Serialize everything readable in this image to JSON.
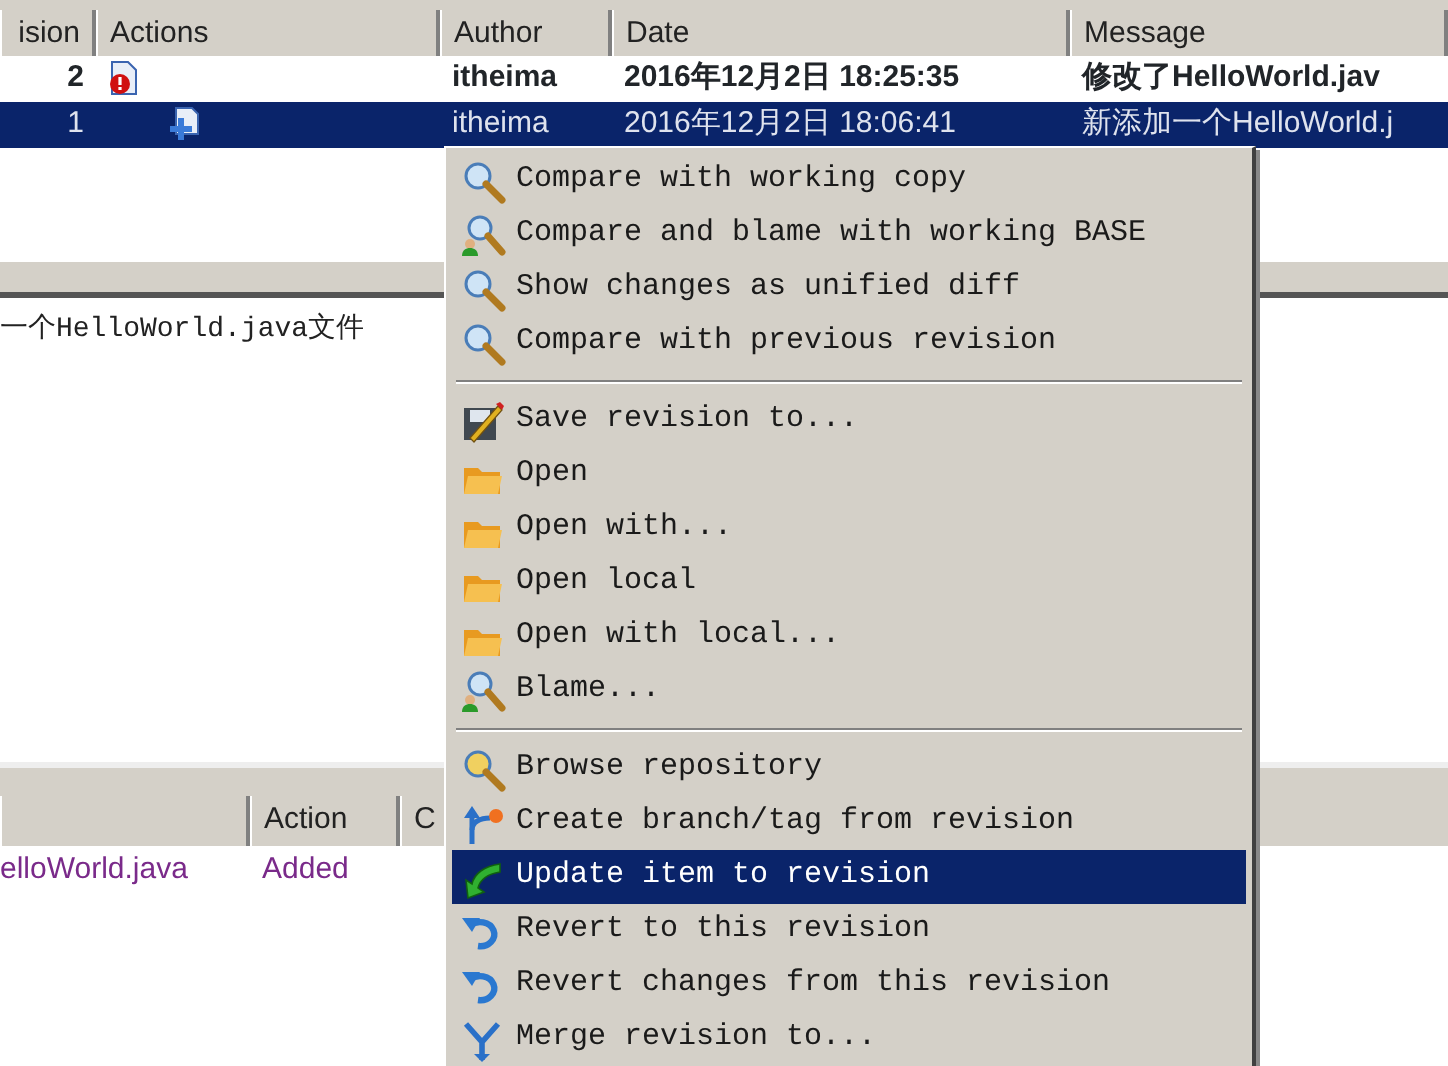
{
  "log_table": {
    "columns": [
      "ision",
      "Actions",
      "Author",
      "Date",
      "Message"
    ],
    "rows": [
      {
        "revision": "2",
        "kind": "modified",
        "author": "itheima",
        "date": "2016年12月2日 18:25:35",
        "message": "修改了HelloWorld.jav",
        "current": true,
        "selected": false
      },
      {
        "revision": "1",
        "kind": "added",
        "author": "itheima",
        "date": "2016年12月2日 18:06:41",
        "message": "新添加一个HelloWorld.j",
        "current": false,
        "selected": true
      }
    ]
  },
  "message_pane": {
    "text": "一个HelloWorld.java文件"
  },
  "paths_table": {
    "columns": [
      "",
      "Action",
      "C"
    ],
    "rows": [
      {
        "path": "elloWorld.java",
        "action": "Added"
      }
    ]
  },
  "context_menu": {
    "groups": [
      [
        {
          "label": "Compare with working copy",
          "kind": "compare",
          "selected": false
        },
        {
          "label": "Compare and blame with working BASE",
          "kind": "blame",
          "selected": false
        },
        {
          "label": "Show changes as unified diff",
          "kind": "compare",
          "selected": false
        },
        {
          "label": "Compare with previous revision",
          "kind": "compare",
          "selected": false
        }
      ],
      [
        {
          "label": "Save revision to...",
          "kind": "save",
          "selected": false
        },
        {
          "label": "Open",
          "kind": "folder",
          "selected": false
        },
        {
          "label": "Open with...",
          "kind": "folder",
          "selected": false
        },
        {
          "label": "Open local",
          "kind": "folder",
          "selected": false
        },
        {
          "label": "Open with local...",
          "kind": "folder",
          "selected": false
        },
        {
          "label": "Blame...",
          "kind": "blame",
          "selected": false
        }
      ],
      [
        {
          "label": "Browse repository",
          "kind": "browse",
          "selected": false
        },
        {
          "label": "Create branch/tag from revision",
          "kind": "branch",
          "selected": false
        },
        {
          "label": "Update item to revision",
          "kind": "update",
          "selected": true
        },
        {
          "label": "Revert to this revision",
          "kind": "revert",
          "selected": false
        },
        {
          "label": "Revert changes from this revision",
          "kind": "revert",
          "selected": false
        },
        {
          "label": "Merge revision to...",
          "kind": "merge",
          "selected": false
        }
      ]
    ]
  }
}
